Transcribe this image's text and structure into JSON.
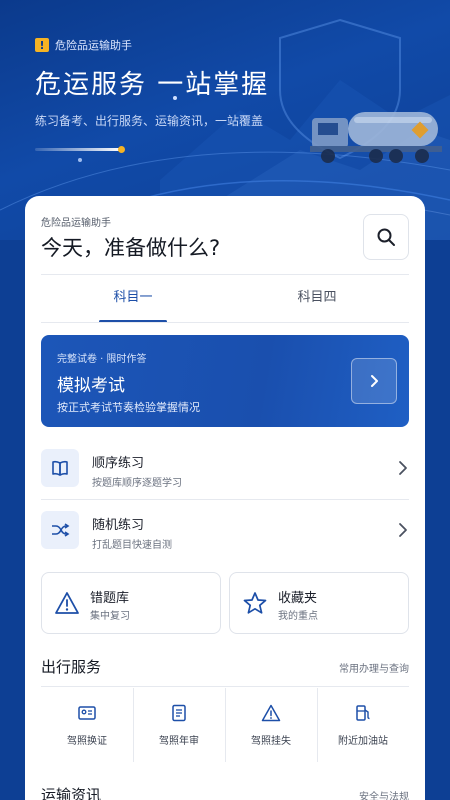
{
  "hero": {
    "badge_text": "危险品运输助手",
    "title": "危运服务  一站掌握",
    "subtitle": "练习备考、出行服务、运输资讯，一站覆盖"
  },
  "card": {
    "app_label": "危险品运输助手",
    "question": "今天，准备做什么?",
    "search_icon": "search-icon"
  },
  "tabs": [
    {
      "label": "科目一",
      "active": true
    },
    {
      "label": "科目四",
      "active": false
    }
  ],
  "exam": {
    "tag": "完整试卷 · 限时作答",
    "title": "模拟考试",
    "desc": "按正式考试节奏检验掌握情况"
  },
  "practice": [
    {
      "title": "顺序练习",
      "sub": "按题库顺序逐题学习",
      "icon": "book-icon"
    },
    {
      "title": "随机练习",
      "sub": "打乱题目快速自测",
      "icon": "shuffle-icon"
    }
  ],
  "tiles": [
    {
      "title": "错题库",
      "sub": "集中复习",
      "icon": "warning-icon"
    },
    {
      "title": "收藏夹",
      "sub": "我的重点",
      "icon": "star-icon"
    }
  ],
  "services_section": {
    "title": "出行服务",
    "link": "常用办理与查询"
  },
  "services": [
    {
      "label": "驾照换证",
      "icon": "id-card-icon"
    },
    {
      "label": "驾照年审",
      "icon": "document-icon"
    },
    {
      "label": "驾照挂失",
      "icon": "alert-icon"
    },
    {
      "label": "附近加油站",
      "icon": "fuel-pump-icon"
    }
  ],
  "news_section": {
    "title": "运输资讯",
    "link": "安全与法规"
  },
  "colors": {
    "primary": "#1d4fa8",
    "hero_bg": "#0d3f94",
    "accent": "#f5b324"
  }
}
